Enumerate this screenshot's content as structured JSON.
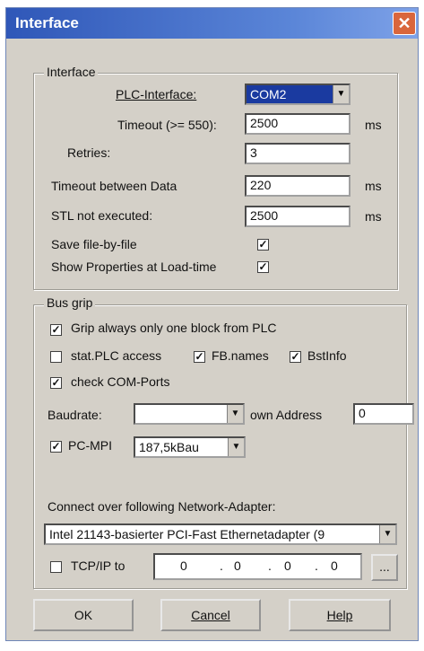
{
  "window": {
    "title": "Interface",
    "close_glyph": "✕"
  },
  "interface_group": {
    "legend": "Interface",
    "plc_interface_label": "PLC-Interface:",
    "plc_interface_value": "COM2",
    "timeout_label": "Timeout (>= 550):",
    "timeout_value": "2500",
    "timeout_unit": "ms",
    "retries_label": "Retries:",
    "retries_value": "3",
    "timeout_between_label": "Timeout between Data",
    "timeout_between_value": "220",
    "timeout_between_unit": "ms",
    "stl_label": "STL not executed:",
    "stl_value": "2500",
    "stl_unit": "ms",
    "save_file_label": "Save file-by-file",
    "save_file_checked": true,
    "show_props_label": "Show Properties at Load-time",
    "show_props_checked": true
  },
  "bus_group": {
    "legend": "Bus grip",
    "grip_label": "Grip always only one block from PLC",
    "grip_checked": true,
    "stat_label": "stat.PLC access",
    "stat_checked": false,
    "fb_label": "FB.names",
    "fb_checked": true,
    "bst_label": "BstInfo",
    "bst_checked": true,
    "check_com_label": "check COM-Ports",
    "check_com_checked": true,
    "baudrate_label": "Baudrate:",
    "baudrate_value": "",
    "own_address_label": "own Address",
    "own_address_value": "0",
    "pcmpi_label": "PC-MPI",
    "pcmpi_checked": true,
    "pcmpi_value": "187,5kBau",
    "network_label": "Connect over following Network-Adapter:",
    "network_value": "Intel 21143-basierter PCI-Fast Ethernetadapter (9",
    "tcp_label": "TCP/IP to",
    "tcp_checked": false,
    "ip": [
      "0",
      "0",
      "0",
      "0"
    ],
    "ip_browse_label": "..."
  },
  "buttons": {
    "ok": "OK",
    "cancel": "Cancel",
    "help": "Help"
  },
  "icons": {
    "dropdown": "chevron-down-icon",
    "check": "check-icon"
  }
}
